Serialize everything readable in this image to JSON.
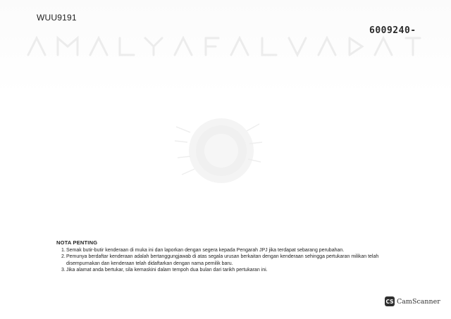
{
  "document": {
    "plate_number": "WUU9191",
    "serial_number": "6009240-"
  },
  "notes": {
    "title": "NOTA PENTING",
    "items": [
      {
        "num": "1.",
        "text": "Semak butir-butir kenderaan di muka ini dan laporkan dengan segera kepada Pengarah JPJ jika terdapat sebarang perubahan.",
        "cont": ""
      },
      {
        "num": "2.",
        "text": "Pemunya berdaftar kenderaan adalah bertanggungjawab di atas segala urusan berkaitan dengan kenderaan sehingga pertukaran milikan telah",
        "cont": "disempurnakan dan kenderaan telah didaftarkan dengan nama pemilik baru."
      },
      {
        "num": "3.",
        "text": "Jika alamat anda bertukar, sila kemaskini dalam tempoh dua bulan dari tarikh pertukaran ini.",
        "cont": ""
      }
    ]
  },
  "watermark": {
    "logo_text": "CS",
    "label": "CamScanner"
  }
}
